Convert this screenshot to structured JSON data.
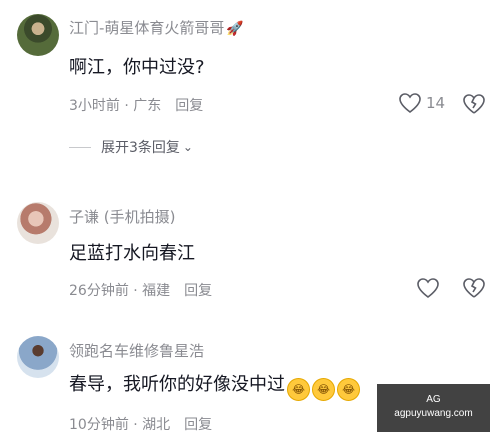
{
  "comments": [
    {
      "username": "江门-萌星体育火箭哥哥",
      "username_icon": "rocket-icon",
      "text": "啊江，你中过没?",
      "time_location": "3小时前 · 广东",
      "reply_label": "回复",
      "like_count": "14",
      "expand_replies": "展开3条回复"
    },
    {
      "username": "子谦 (手机拍摄)",
      "text": "足蓝打水向春江",
      "time_location": "26分钟前 · 福建",
      "reply_label": "回复",
      "like_count": ""
    },
    {
      "username": "领跑名车维修鲁星浩",
      "text": "春导，我听你的好像没中过",
      "emojis": [
        "laugh-cry-emoji",
        "laugh-cry-emoji",
        "laugh-cry-emoji"
      ],
      "time_location": "10分钟前 · 湖北",
      "reply_label": "回复",
      "like_count": ""
    }
  ],
  "watermark": {
    "line1": "AG",
    "line2": "agpuyuwang.com"
  },
  "colors": {
    "text": "#161823",
    "secondary": "#8a8b91",
    "background": "#ffffff"
  }
}
